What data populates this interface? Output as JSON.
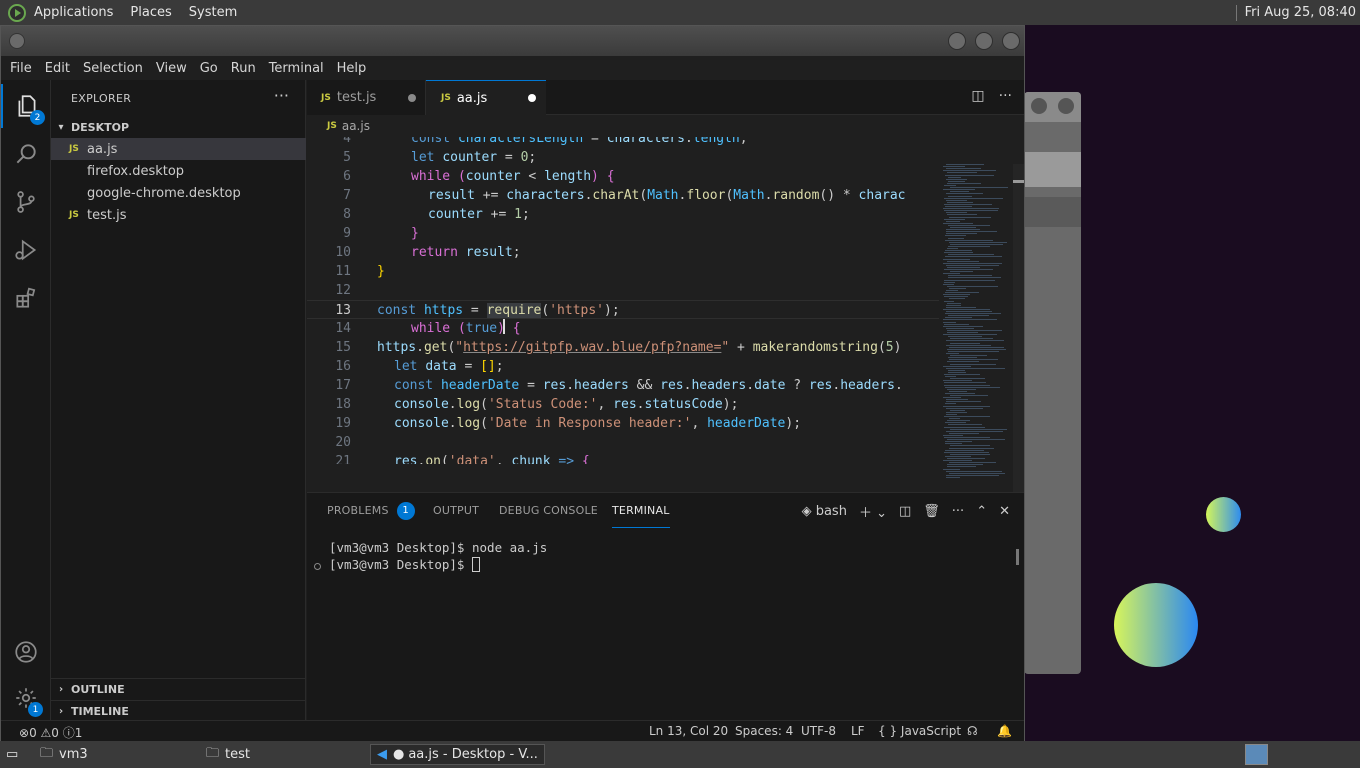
{
  "top_panel": {
    "menus": [
      "Applications",
      "Places",
      "System"
    ],
    "clock": "Fri Aug 25, 08:40"
  },
  "menubar": [
    "File",
    "Edit",
    "Selection",
    "View",
    "Go",
    "Run",
    "Terminal",
    "Help"
  ],
  "activity_bar": {
    "explorer_badge": "2",
    "settings_badge": "1"
  },
  "sidebar": {
    "header": "EXPLORER",
    "more": "···",
    "folder": "DESKTOP",
    "files": [
      {
        "name": "aa.js",
        "type": "js",
        "selected": true
      },
      {
        "name": "firefox.desktop",
        "type": "desktop"
      },
      {
        "name": "google-chrome.desktop",
        "type": "desktop"
      },
      {
        "name": "test.js",
        "type": "js"
      }
    ],
    "outline": "OUTLINE",
    "timeline": "TIMELINE"
  },
  "tabs": [
    {
      "label": "test.js",
      "icon": "JS",
      "modified": true
    },
    {
      "label": "aa.js",
      "icon": "JS",
      "modified": true,
      "active": true
    }
  ],
  "breadcrumb": {
    "icon": "JS",
    "file": "aa.js"
  },
  "code": {
    "line_numbers": [
      "4",
      "5",
      "6",
      "7",
      "8",
      "9",
      "10",
      "11",
      "12",
      "13",
      "14",
      "15",
      "16",
      "17",
      "18",
      "19",
      "20",
      "21"
    ],
    "current_line": "13"
  },
  "panel": {
    "tabs": [
      "PROBLEMS",
      "OUTPUT",
      "DEBUG CONSOLE",
      "TERMINAL"
    ],
    "problems_count": "1",
    "shell": "bash",
    "terminal_lines": [
      "[vm3@vm3 Desktop]$ node aa.js",
      "[vm3@vm3 Desktop]$ "
    ]
  },
  "statusbar": {
    "errors": "0",
    "warnings": "0",
    "info": "1",
    "position": "Ln 13, Col 20",
    "spaces": "Spaces: 4",
    "encoding": "UTF-8",
    "eol": "LF",
    "language": "JavaScript",
    "language_icon": "{ }"
  },
  "taskbar": {
    "items": [
      "vm3",
      "test",
      "aa.js - Desktop - V..."
    ]
  },
  "colors": {
    "accent": "#0078d4",
    "editor_bg": "#1f1f1f",
    "sidebar_bg": "#181818"
  }
}
